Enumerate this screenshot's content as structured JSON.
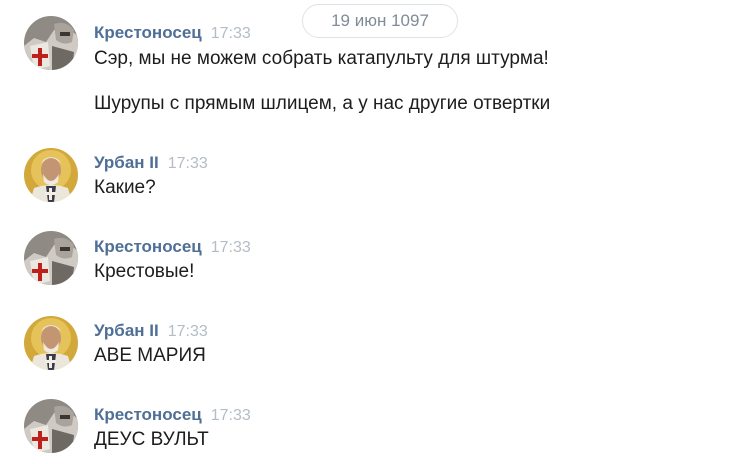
{
  "date_divider": "19 июн 1097",
  "messages": [
    {
      "author": "Крестоносец",
      "time": "17:33",
      "avatar": "crusader-avatar",
      "lines": [
        "Сэр, мы не можем собрать катапульту для штурма!",
        "Шурупы с прямым шлицем, а у нас другие отвертки"
      ]
    },
    {
      "author": "Урбан II",
      "time": "17:33",
      "avatar": "pope-avatar",
      "lines": [
        "Какие?"
      ]
    },
    {
      "author": "Крестоносец",
      "time": "17:33",
      "avatar": "crusader-avatar",
      "lines": [
        "Крестовые!"
      ]
    },
    {
      "author": "Урбан II",
      "time": "17:33",
      "avatar": "pope-avatar",
      "lines": [
        "АВЕ МАРИЯ"
      ]
    },
    {
      "author": "Крестоносец",
      "time": "17:33",
      "avatar": "crusader-avatar",
      "lines": [
        "ДЕУС ВУЛЬТ"
      ]
    }
  ],
  "colors": {
    "author": "#4f6f97",
    "time": "#b4bcc6",
    "text": "#1d1d1d",
    "divider_border": "#dfe3e8"
  }
}
